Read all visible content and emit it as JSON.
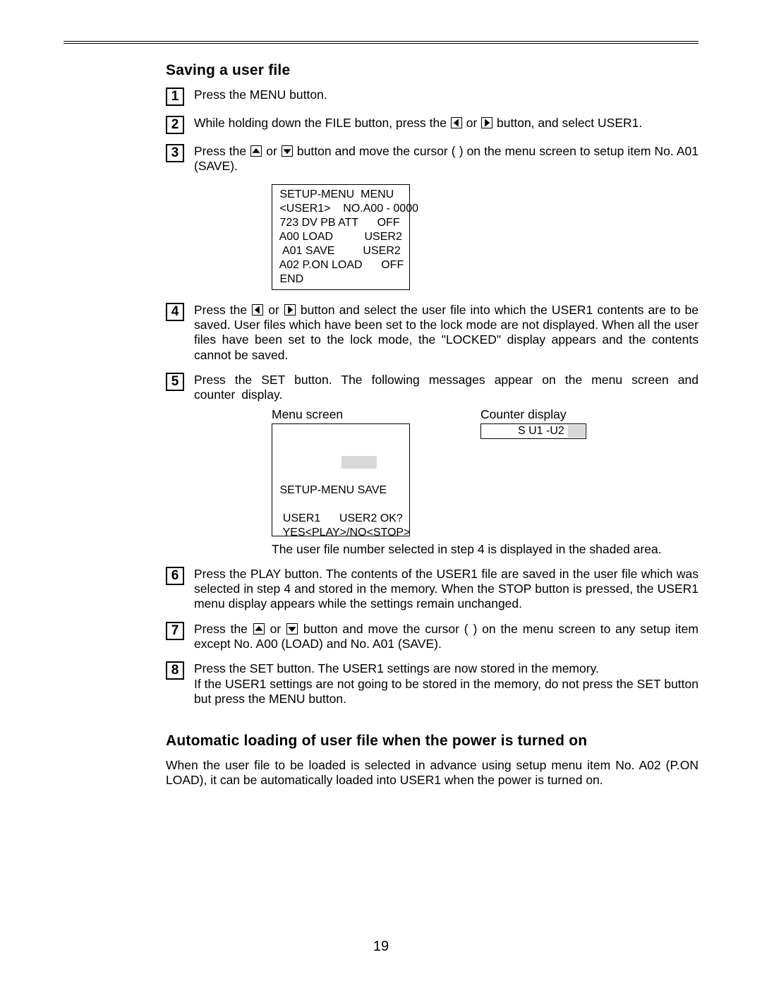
{
  "title1": "Saving a user file",
  "steps": {
    "s1": {
      "num": "1",
      "text": "Press the MENU button."
    },
    "s2": {
      "num": "2",
      "pre": "While holding down the FILE button, press the ",
      "mid": " or ",
      "post": " button, and select USER1."
    },
    "s3": {
      "num": "3",
      "pre": "Press the ",
      "mid": " or ",
      "post": " button and move the cursor (   ) on the menu screen to setup item No. A01 (SAVE)."
    },
    "s4": {
      "num": "4",
      "pre": "Press the ",
      "mid": " or ",
      "post": " button and select the user file into which the USER1 contents are to be saved. User files which have been set to the lock mode are not displayed. When all the user files have been set to the lock mode, the \"LOCKED\" display appears and the contents cannot be saved."
    },
    "s5": {
      "num": "5",
      "text": "Press the SET button. The following messages appear on the menu screen and counter display."
    },
    "s6": {
      "num": "6",
      "text": "Press the PLAY button. The contents of the USER1 file are saved in the user file which was selected in step 4 and stored in the memory. When the STOP button is pressed, the USER1 menu display appears while the settings remain unchanged."
    },
    "s7": {
      "num": "7",
      "pre": "Press the ",
      "mid": " or ",
      "post": " button and move the cursor (   ) on the menu screen to any setup item except No. A00 (LOAD) and No. A01 (SAVE)."
    },
    "s8": {
      "num": "8",
      "text": "Press the SET button. The USER1 settings are now stored in the memory.\nIf the USER1 settings are not going to be stored in the memory, do not press the SET button but press the MENU button."
    }
  },
  "screen1": " SETUP-MENU  MENU\n <USER1>    NO.A00 - 0000\n 723 DV PB ATT      OFF\n A00 LOAD          USER2\n  A01 SAVE         USER2\n A02 P.ON LOAD      OFF\n END",
  "fig_labels": {
    "menu": "Menu screen",
    "counter": "Counter display"
  },
  "screen2_line1": " SETUP-MENU SAVE",
  "screen2_line2": "  USER1      USER2 OK?",
  "screen2_line3": "  YES<PLAY>/NO<STOP>",
  "screen2_arrow": "→",
  "counter_text": "S U1 -U2",
  "note": "The user file number selected in step 4 is displayed in the shaded area.",
  "title2": "Automatic loading of user file when the power is turned on",
  "body2": "When the user file to be loaded is selected in advance using setup menu item No. A02 (P.ON LOAD), it can be automatically loaded into USER1 when the power is turned on.",
  "page_num": "19"
}
